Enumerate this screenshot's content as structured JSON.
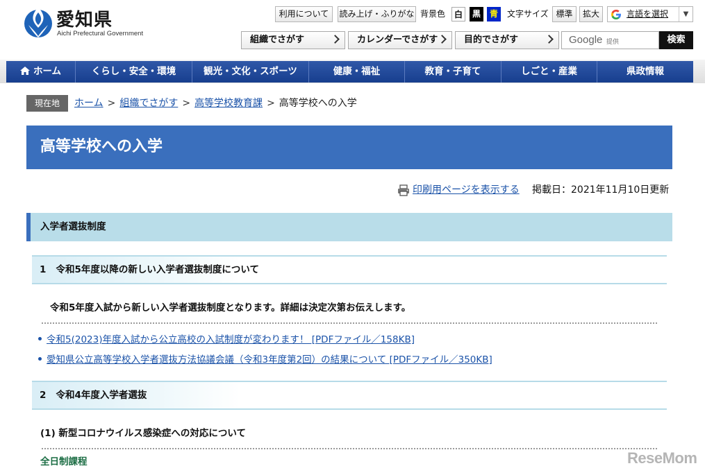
{
  "header": {
    "logo_name": "愛知県",
    "logo_sub": "Aichi Prefectural Government",
    "usage_label": "利用について",
    "reading_label": "読み上げ・ふりがな",
    "bgcolor_label": "背景色",
    "bg_white": "白",
    "bg_black": "黒",
    "bg_blue": "青",
    "fontsize_label": "文字サイズ",
    "size_standard": "標準",
    "size_large": "拡大",
    "language_label": "言語を選択",
    "language_arrow": "▼",
    "finders": [
      "組織でさがす",
      "カレンダーでさがす",
      "目的でさがす"
    ],
    "search_logo": "Google",
    "search_provided": "提供",
    "search_button": "検索",
    "colors": {
      "accent": "#3a6fbd",
      "nav": "#173e8e",
      "section": "#b9dde9",
      "link": "#1a52a8"
    }
  },
  "nav": {
    "items": [
      "ホーム",
      "くらし・安全・環境",
      "観光・文化・スポーツ",
      "健康・福祉",
      "教育・子育て",
      "しごと・産業",
      "県政情報"
    ]
  },
  "breadcrumb": {
    "tag": "現在地",
    "links": [
      "ホーム",
      "組織でさがす",
      "高等学校教育課"
    ],
    "separator": ">",
    "current": "高等学校への入学"
  },
  "main": {
    "title": "高等学校への入学",
    "print_link": "印刷用ページを表示する",
    "published": "掲載日：2021年11月10日更新",
    "section_title": "入学者選抜制度",
    "sub1": {
      "num": "1",
      "title": "令和5年度以降の新しい入学者選抜制度について"
    },
    "notice": "令和5年度入試から新しい入学者選抜制度となります。詳細は決定次第お伝えします。",
    "links": [
      "令和5(2023)年度入試から公立高校の入試制度が変わります！ [PDFファイル／158KB]",
      "愛知県公立高等学校入学者選抜方法協議会議（令和3年度第2回）の結果について [PDFファイル／350KB]"
    ],
    "sub2": {
      "num": "2",
      "title": "令和4年度入学者選抜"
    },
    "sub2_1": "(1) 新型コロナウイルス感染症への対応について",
    "fulltime": "全日制課程"
  },
  "watermark": "ReseMom"
}
